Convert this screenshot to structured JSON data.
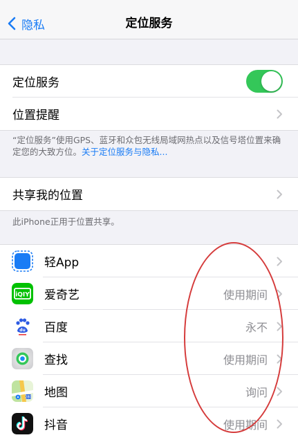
{
  "nav": {
    "back_label": "隐私",
    "title": "定位服务"
  },
  "location": {
    "toggle_label": "定位服务",
    "toggle_on": true,
    "alerts_label": "位置提醒"
  },
  "footnote1": {
    "text": "“定位服务”使用GPS、蓝牙和众包无线局域网热点以及信号塔位置来确定您的大致方位。",
    "link": "关于定位服务与隐私..."
  },
  "share": {
    "label": "共享我的位置"
  },
  "footnote2": "此iPhone正用于位置共享。",
  "apps": [
    {
      "name": "轻App",
      "value": "",
      "icon": "light-app-icon"
    },
    {
      "name": "爱奇艺",
      "value": "使用期间",
      "icon": "iqiyi-icon"
    },
    {
      "name": "百度",
      "value": "永不",
      "icon": "baidu-icon"
    },
    {
      "name": "查找",
      "value": "使用期间",
      "icon": "find-my-icon"
    },
    {
      "name": "地图",
      "value": "询问",
      "icon": "maps-icon"
    },
    {
      "name": "抖音",
      "value": "使用期间",
      "icon": "tiktok-icon"
    }
  ],
  "colors": {
    "accent": "#1a7cf5",
    "toggle_on": "#34c759",
    "annotation": "#d53b3b"
  }
}
